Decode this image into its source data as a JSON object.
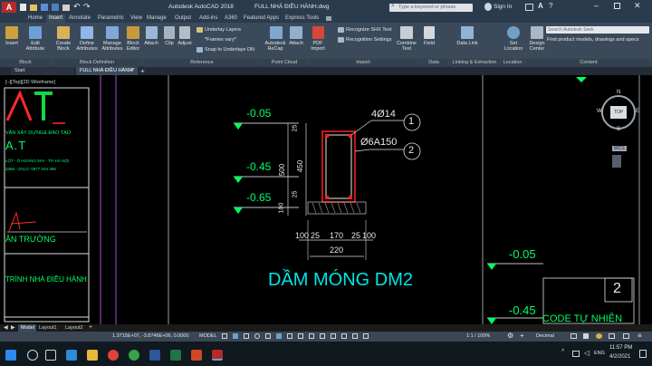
{
  "titlebar": {
    "app_title": "Autodesk AutoCAD 2018",
    "file_title": "FULL NHÀ ĐIỀU HÀNH.dwg",
    "search_placeholder": "Type a keyword or phrase",
    "sign_in": "Sign In"
  },
  "ribbon_tabs": [
    "Home",
    "Insert",
    "Annotate",
    "Parametric",
    "View",
    "Manage",
    "Output",
    "Add-ins",
    "A360",
    "Featured Apps",
    "Express Tools"
  ],
  "ribbon_tools": {
    "insert": "Insert",
    "edit_attribute": "Edit Attribute",
    "create_block": "Create Block",
    "define_attributes": "Define Attributes",
    "manage_attributes": "Manage Attributes",
    "block_editor": "Block Editor",
    "attach": "Attach",
    "clip": "Clip",
    "adjust": "Adjust",
    "underlay_layers": "Underlay Layers",
    "frames_vary": "*Frames vary*",
    "snap_underlays": "Snap to Underlays ON",
    "autodesk_recap": "Autodesk ReCap",
    "attach_cloud": "Attach",
    "pdf_import": "PDF Import",
    "recognize_shx": "Recognize SHX Text",
    "recognition_settings": "Recognition Settings",
    "combine_text": "Combine Text",
    "field": "Field",
    "data_link": "Data Link",
    "set_location": "Set Location",
    "design_center": "Design Center",
    "search_autodesk": "Search Autodesk Seek",
    "find_products": "Find product models, drawings and specs"
  },
  "ribbon_groups": {
    "block": "Block",
    "block_definition": "Block Definition",
    "reference": "Reference",
    "point_cloud": "Point Cloud",
    "import": "Import",
    "data": "Data",
    "linking": "Linking & Extraction",
    "location": "Location",
    "content": "Content"
  },
  "doc_tabs": [
    "Start",
    "FULL NHÀ ĐIỀU HÀNH*"
  ],
  "viewport_label": "[–][Top][2D Wireframe]",
  "drawing": {
    "levels": [
      "-0.05",
      "-0.45",
      "-0.65"
    ],
    "side_dims": [
      "25",
      "500",
      "450",
      "25",
      "100"
    ],
    "bottom_dims": [
      "100",
      "25",
      "170",
      "25",
      "100"
    ],
    "total_width": "220",
    "rebar_top": "4Ø14",
    "stirrup": "Ø6A150",
    "callout_1": "1",
    "callout_2": "2",
    "section_title": "DẦM MÓNG DM2",
    "right_level_1": "-0.05",
    "right_level_2": "-0.45",
    "right_callout": "2",
    "right_code_text": "CODE TỰ NHIÊN"
  },
  "left_panel": {
    "logo_text": "AT",
    "company_line": "VĂN XÂY DỰNG& ĐÀO TẠO",
    "company_name": "A.T",
    "address": "LỘT - Ô HOÀNG MAI - TP. HÀ NỘI",
    "phone": "3368 - ZALO: 0977 034 368",
    "field_label": "ÂN TRƯỜNG",
    "project_label": "TRÌNH NHÀ ĐIỀU HÀNH"
  },
  "navcube": {
    "top": "TOP",
    "north": "N",
    "south": "S",
    "east": "E",
    "west": "W",
    "wcs": "WCS"
  },
  "layout_tabs": [
    "Model",
    "Layout1",
    "Layout2"
  ],
  "statusbar": {
    "coords": "1.3715E+07, -3.8746E+06, 0.0000",
    "model": "MODEL",
    "scale": "1:1 / 100%",
    "units": "Decimal"
  },
  "taskbar": {
    "lang": "ENG",
    "time": "11:57 PM",
    "date": "4/2/2021"
  },
  "colors": {
    "green": "#00ff00",
    "cyan": "#00e5e5",
    "red": "#ff2020",
    "ribbon": "#3b4a5b"
  }
}
